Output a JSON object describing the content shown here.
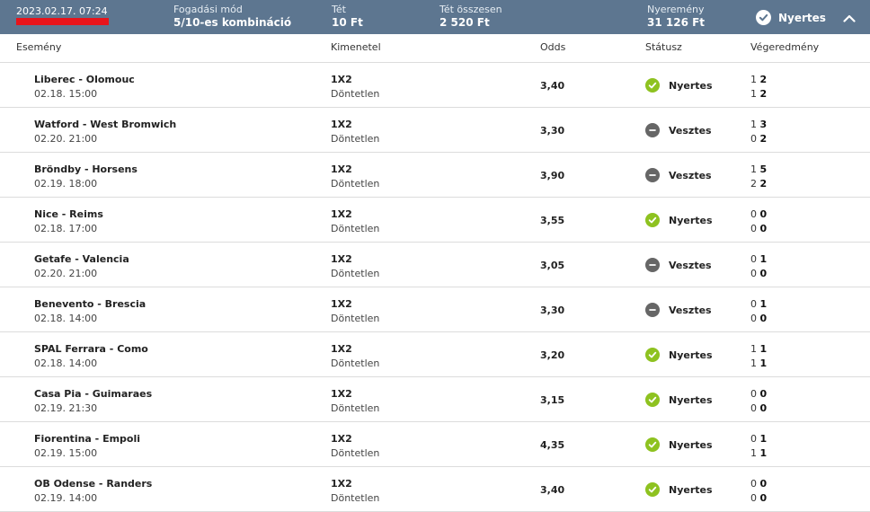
{
  "header": {
    "date": "2023.02.17. 07:24",
    "bet_type_label": "Fogadási mód",
    "bet_type_value": "5/10-es kombináció",
    "stake_label": "Tét",
    "stake_value": "10 Ft",
    "total_stake_label": "Tét összesen",
    "total_stake_value": "2 520 Ft",
    "winnings_label": "Nyeremény",
    "winnings_value": "31 126 Ft",
    "status": "Nyertes",
    "colors": {
      "header_bg": "#5d7690",
      "win": "#8ec220",
      "lose": "#666666",
      "redaction": "#e8141b"
    }
  },
  "columns": {
    "event": "Esemény",
    "market": "Kimenetel",
    "odds": "Odds",
    "status": "Státusz",
    "result": "Végeredmény"
  },
  "rows": [
    {
      "event": "Liberec - Olomouc",
      "date": "02.18. 15:00",
      "market": "1X2",
      "selection": "Döntetlen",
      "odds": "3,40",
      "status": "Nyertes",
      "win": true,
      "s1a": "1",
      "s1b": "2",
      "s2a": "1",
      "s2b": "2"
    },
    {
      "event": "Watford - West Bromwich",
      "date": "02.20. 21:00",
      "market": "1X2",
      "selection": "Döntetlen",
      "odds": "3,30",
      "status": "Vesztes",
      "win": false,
      "s1a": "1",
      "s1b": "3",
      "s2a": "0",
      "s2b": "2"
    },
    {
      "event": "Bröndby - Horsens",
      "date": "02.19. 18:00",
      "market": "1X2",
      "selection": "Döntetlen",
      "odds": "3,90",
      "status": "Vesztes",
      "win": false,
      "s1a": "1",
      "s1b": "5",
      "s2a": "2",
      "s2b": "2"
    },
    {
      "event": "Nice - Reims",
      "date": "02.18. 17:00",
      "market": "1X2",
      "selection": "Döntetlen",
      "odds": "3,55",
      "status": "Nyertes",
      "win": true,
      "s1a": "0",
      "s1b": "0",
      "s2a": "0",
      "s2b": "0"
    },
    {
      "event": "Getafe - Valencia",
      "date": "02.20. 21:00",
      "market": "1X2",
      "selection": "Döntetlen",
      "odds": "3,05",
      "status": "Vesztes",
      "win": false,
      "s1a": "0",
      "s1b": "1",
      "s2a": "0",
      "s2b": "0"
    },
    {
      "event": "Benevento - Brescia",
      "date": "02.18. 14:00",
      "market": "1X2",
      "selection": "Döntetlen",
      "odds": "3,30",
      "status": "Vesztes",
      "win": false,
      "s1a": "0",
      "s1b": "1",
      "s2a": "0",
      "s2b": "0"
    },
    {
      "event": "SPAL Ferrara - Como",
      "date": "02.18. 14:00",
      "market": "1X2",
      "selection": "Döntetlen",
      "odds": "3,20",
      "status": "Nyertes",
      "win": true,
      "s1a": "1",
      "s1b": "1",
      "s2a": "1",
      "s2b": "1"
    },
    {
      "event": "Casa Pia - Guimaraes",
      "date": "02.19. 21:30",
      "market": "1X2",
      "selection": "Döntetlen",
      "odds": "3,15",
      "status": "Nyertes",
      "win": true,
      "s1a": "0",
      "s1b": "0",
      "s2a": "0",
      "s2b": "0"
    },
    {
      "event": "Fiorentina - Empoli",
      "date": "02.19. 15:00",
      "market": "1X2",
      "selection": "Döntetlen",
      "odds": "4,35",
      "status": "Nyertes",
      "win": true,
      "s1a": "0",
      "s1b": "1",
      "s2a": "1",
      "s2b": "1"
    },
    {
      "event": "OB Odense - Randers",
      "date": "02.19. 14:00",
      "market": "1X2",
      "selection": "Döntetlen",
      "odds": "3,40",
      "status": "Nyertes",
      "win": true,
      "s1a": "0",
      "s1b": "0",
      "s2a": "0",
      "s2b": "0"
    }
  ]
}
